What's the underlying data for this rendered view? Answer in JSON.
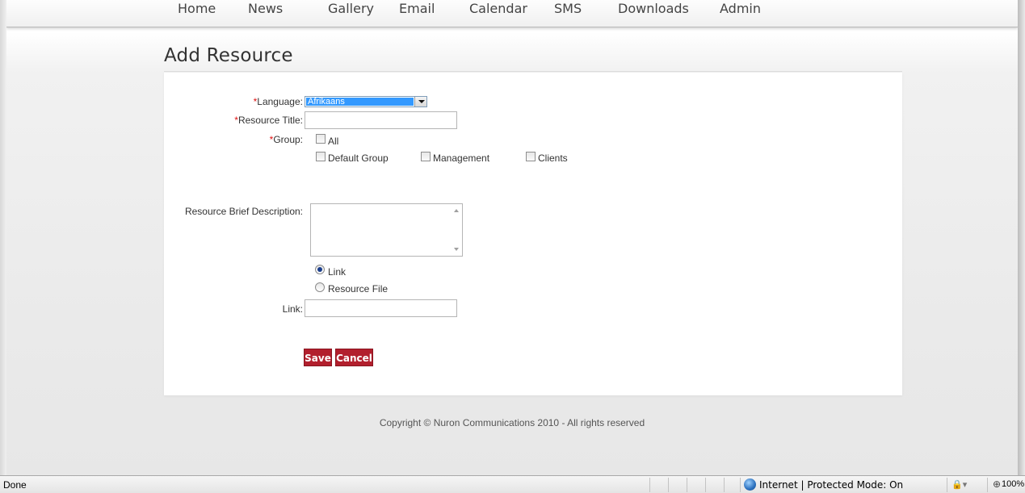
{
  "nav": {
    "items": [
      "Home",
      "News",
      "Gallery",
      "Email",
      "Calendar",
      "SMS",
      "Downloads",
      "Admin"
    ]
  },
  "page": {
    "title": "Add Resource"
  },
  "form": {
    "required_mark": "*",
    "language_label": "Language:",
    "language_value": "Afrikaans",
    "title_label": "Resource Title:",
    "title_value": "",
    "group_label": "Group:",
    "groups": [
      {
        "label": "All",
        "checked": false
      },
      {
        "label": "Default Group",
        "checked": false
      },
      {
        "label": "Management",
        "checked": false
      },
      {
        "label": "Clients",
        "checked": false
      }
    ],
    "description_label": "Resource Brief Description:",
    "description_value": "",
    "resource_type_options": [
      {
        "label": "Link",
        "selected": true
      },
      {
        "label": "Resource File",
        "selected": false
      }
    ],
    "link_label": "Link:",
    "link_value": "",
    "save_label": "Save",
    "cancel_label": "Cancel"
  },
  "footer": {
    "copyright": "Copyright © Nuron Communications 2010 - All rights reserved"
  },
  "status_bar": {
    "status": "Done",
    "zone": "Internet | Protected Mode: On",
    "zoom": "100%"
  },
  "colors": {
    "required": "#dd1111",
    "button": "#b21f2d",
    "selection": "#3399ff"
  },
  "icons": {
    "zone": "globe-icon",
    "security": "lock-icon",
    "zoom": "zoom-icon"
  }
}
